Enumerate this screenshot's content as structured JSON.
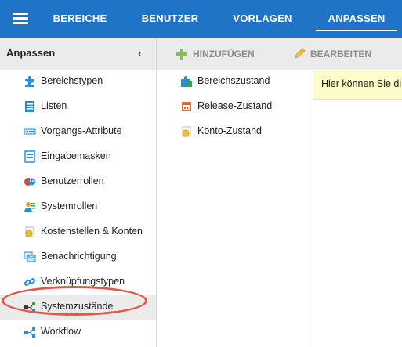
{
  "colors": {
    "topbar": "#1f74c7",
    "highlight": "#e05a4a",
    "info_bg": "#fdfdc9"
  },
  "topbar": {
    "menu_icon": "hamburger-menu-icon",
    "nav": [
      "BEREICHE",
      "BENUTZER",
      "VORLAGEN",
      "ANPASSEN"
    ],
    "active": "ANPASSEN"
  },
  "sidebar": {
    "title": "Anpassen",
    "collapse_icon": "chevron-left-icon",
    "items": [
      {
        "label": "Bereichstypen",
        "icon": "puzzle-icon"
      },
      {
        "label": "Listen",
        "icon": "list-icon"
      },
      {
        "label": "Vorgangs-Attribute",
        "icon": "attribute-icon"
      },
      {
        "label": "Eingabemasken",
        "icon": "form-icon"
      },
      {
        "label": "Benutzerrollen",
        "icon": "masks-icon"
      },
      {
        "label": "Systemrollen",
        "icon": "user-role-icon"
      },
      {
        "label": "Kostenstellen & Konten",
        "icon": "coins-icon"
      },
      {
        "label": "Benachrichtigung",
        "icon": "notification-icon"
      },
      {
        "label": "Verknüpfungstypen",
        "icon": "link-icon"
      },
      {
        "label": "Systemzustände",
        "icon": "state-flow-icon",
        "selected": true
      },
      {
        "label": "Workflow",
        "icon": "workflow-icon"
      }
    ]
  },
  "toolbar": {
    "add_label": "HINZUFÜGEN",
    "edit_label": "BEARBEITEN"
  },
  "list": {
    "items": [
      {
        "label": "Bereichszustand",
        "icon": "area-state-icon"
      },
      {
        "label": "Release-Zustand",
        "icon": "calendar-icon"
      },
      {
        "label": "Konto-Zustand",
        "icon": "account-coins-icon"
      }
    ]
  },
  "info": {
    "text": "Hier können Sie di"
  }
}
